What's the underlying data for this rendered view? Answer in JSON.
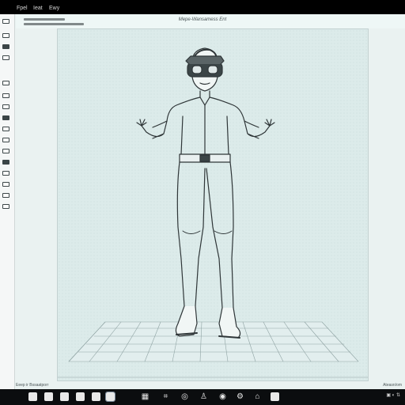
{
  "app": {
    "menu": [
      "Fpel",
      "Ieat",
      "Ewy"
    ],
    "canvas_title": "Mepe-Wansamess Ent",
    "status_left": "Eeep ir Bssaatporr",
    "status_right": "Ateasn/om"
  },
  "toolbar_icons": [
    "file-icon",
    "layers-icon",
    "folder-icon",
    "calendar-icon",
    "mail-icon",
    "chevron-right-icon",
    "grid-icon",
    "crop-icon",
    "globe-icon",
    "person-icon",
    "camera-icon",
    "settings-icon",
    "lock-icon"
  ],
  "colors": {
    "background": "#eaf2f1",
    "canvas": "#dcebea",
    "ink": "#2f3638",
    "taskbar": "#0b0d0f"
  }
}
